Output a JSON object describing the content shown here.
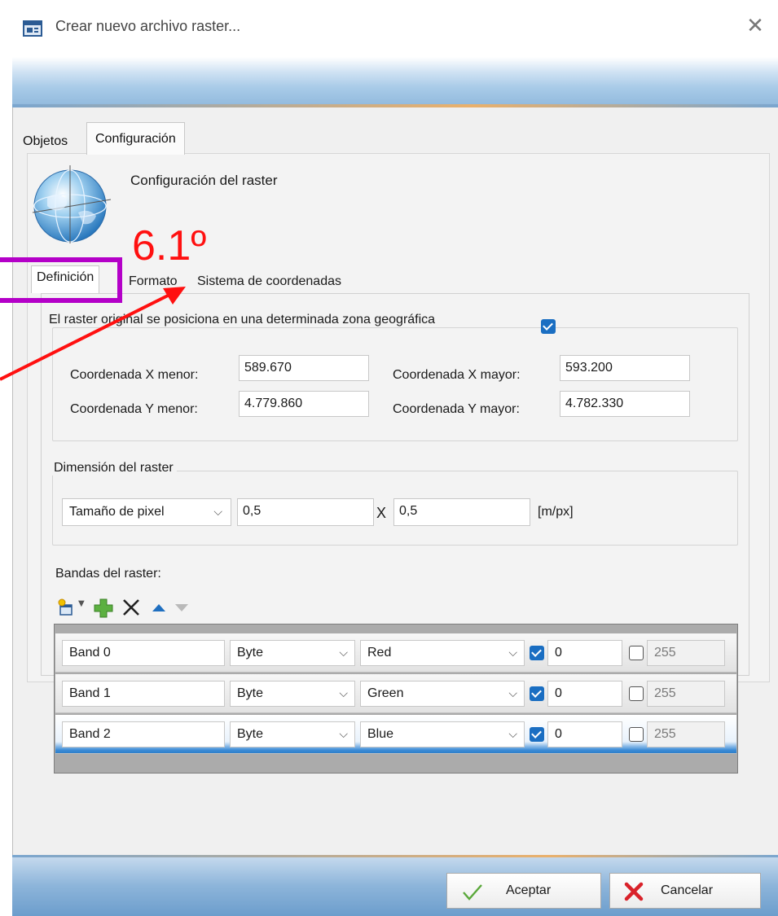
{
  "window": {
    "title": "Crear nuevo archivo raster...",
    "close_icon": "close-icon"
  },
  "outer_tabs": {
    "objetos": "Objetos",
    "configuracion": "Configuración"
  },
  "config": {
    "title": "Configuración del raster"
  },
  "inner_tabs": {
    "definicion": "Definición",
    "formato": "Formato",
    "sistema": "Sistema de coordenadas"
  },
  "geo": {
    "checkbox_label": "El raster original se posiciona en una determinada zona geográfica",
    "checked": true,
    "x_min_label": "Coordenada X menor:",
    "x_min": "589.670",
    "x_max_label": "Coordenada X mayor:",
    "x_max": "593.200",
    "y_min_label": "Coordenada Y menor:",
    "y_min": "4.779.860",
    "y_max_label": "Coordenada Y mayor:",
    "y_max": "4.782.330"
  },
  "dimension": {
    "legend": "Dimensión del raster",
    "mode": "Tamaño de pixel",
    "width": "0,5",
    "separator": "X",
    "height": "0,5",
    "units": "[m/px]"
  },
  "bands": {
    "label": "Bandas del raster:",
    "rows": [
      {
        "name": "Band 0",
        "type": "Byte",
        "color": "Red",
        "min_checked": true,
        "min": "0",
        "max_checked": false,
        "max": "255"
      },
      {
        "name": "Band 1",
        "type": "Byte",
        "color": "Green",
        "min_checked": true,
        "min": "0",
        "max_checked": false,
        "max": "255"
      },
      {
        "name": "Band 2",
        "type": "Byte",
        "color": "Blue",
        "min_checked": true,
        "min": "0",
        "max_checked": false,
        "max": "255"
      }
    ]
  },
  "buttons": {
    "ok": "Aceptar",
    "cancel": "Cancelar"
  },
  "annotation": {
    "label": "6.1º",
    "box_color": "#b400c8",
    "arrow_color": "#ff1010"
  },
  "colors": {
    "accent": "#1a6ec2",
    "selected_row": "#2d7ec9"
  }
}
